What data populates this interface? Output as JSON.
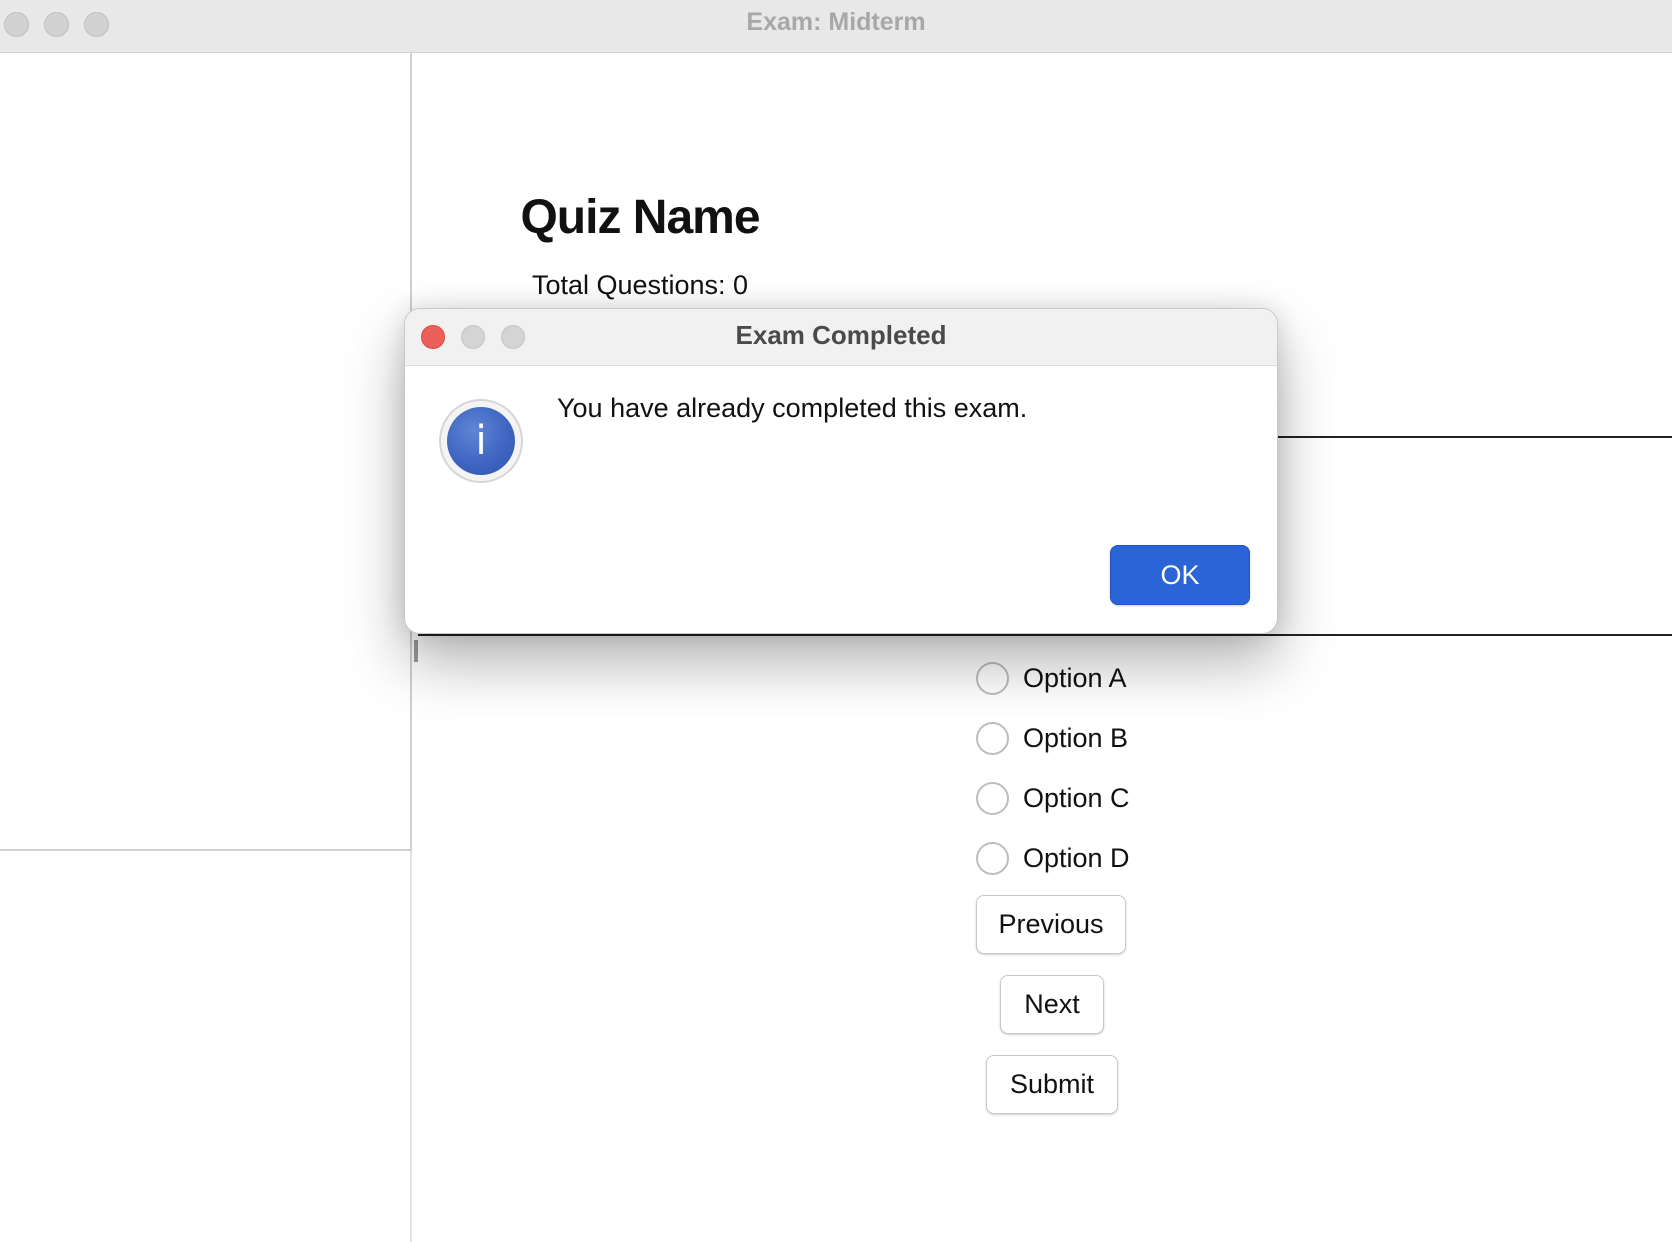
{
  "window": {
    "title": "Exam: Midterm"
  },
  "quiz": {
    "name": "Quiz Name",
    "total_questions": "Total Questions: 0",
    "options": [
      "Option A",
      "Option B",
      "Option C",
      "Option D"
    ],
    "previous_label": "Previous",
    "next_label": "Next",
    "submit_label": "Submit"
  },
  "dialog": {
    "title": "Exam Completed",
    "message": "You have already completed this exam.",
    "icon": "info-icon",
    "icon_glyph": "i",
    "ok_label": "OK"
  },
  "colors": {
    "close_button": "#ec5f58",
    "accent_button": "#2b64d6",
    "info_icon": "#3c63bf"
  }
}
